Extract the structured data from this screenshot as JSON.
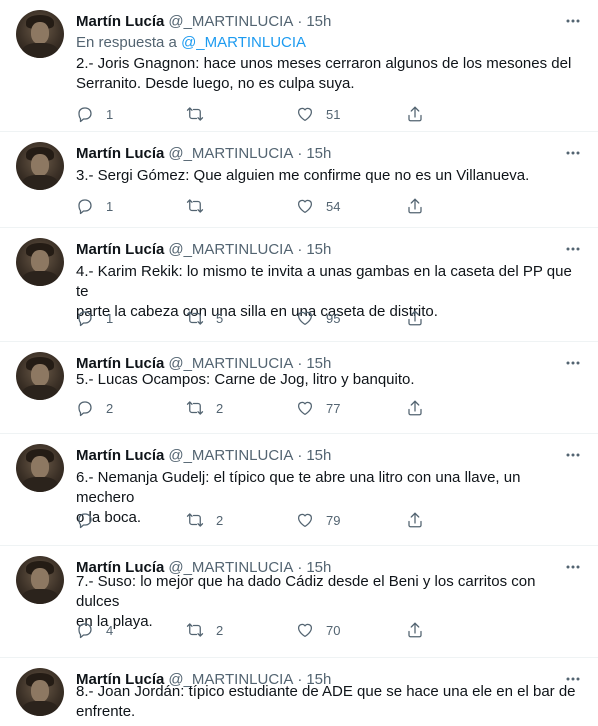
{
  "tweets": [
    {
      "name": "Martín Lucía",
      "handle": "@_MARTINLUCIA",
      "time": "15h",
      "reply_prefix": "En respuesta a",
      "reply_mention": "@_MARTINLUCIA",
      "line1": "2.- Joris Gnagnon: hace unos meses cerraron algunos de los mesones del",
      "line2": "Serranito. Desde luego, no es culpa suya.",
      "replies": "1",
      "retweets": "",
      "likes": "51"
    },
    {
      "name": "Martín Lucía",
      "handle": "@_MARTINLUCIA",
      "time": "15h",
      "line1": "3.- Sergi Gómez: Que alguien me confirme que no es un Villanueva.",
      "line2": "",
      "replies": "1",
      "retweets": "",
      "likes": "54"
    },
    {
      "name": "Martín Lucía",
      "handle": "@_MARTINLUCIA",
      "time": "15h",
      "line1": "4.- Karim Rekik: lo mismo te invita a unas gambas en la caseta del PP que te",
      "line2": "parte la cabeza con una silla en una caseta de distrito.",
      "replies": "1",
      "retweets": "5",
      "likes": "95"
    },
    {
      "name": "Martín Lucía",
      "handle": "@_MARTINLUCIA",
      "time": "15h",
      "line1": "5.- Lucas Ocampos: Carne de Jog, litro y banquito.",
      "line2": "",
      "replies": "2",
      "retweets": "2",
      "likes": "77"
    },
    {
      "name": "Martín Lucía",
      "handle": "@_MARTINLUCIA",
      "time": "15h",
      "line1": "6.- Nemanja Gudelj: el típico que te abre una litro con una llave, un mechero",
      "line2": "o la boca.",
      "replies": "",
      "retweets": "2",
      "likes": "79"
    },
    {
      "name": "Martín Lucía",
      "handle": "@_MARTINLUCIA",
      "time": "15h",
      "line1": "7.- Suso: lo mejor que ha dado Cádiz desde el Beni y los carritos con dulces",
      "line2": "en la playa.",
      "replies": "4",
      "retweets": "2",
      "likes": "70"
    },
    {
      "name": "Martín Lucía",
      "handle": "@_MARTINLUCIA",
      "time": "15h",
      "line1": "8.- Joan Jordán: típico estudiante de ADE que se hace una ele en el bar de",
      "line2": "enfrente.",
      "replies": "",
      "retweets": "",
      "likes": ""
    }
  ],
  "icons": {
    "reply": "reply-icon",
    "retweet": "retweet-icon",
    "like": "heart-icon",
    "share": "share-icon",
    "more": "more-icon"
  },
  "colors": {
    "accent": "#1d9bf0",
    "secondary_text": "#536471",
    "text": "#0f1419",
    "divider": "#eff3f4"
  }
}
